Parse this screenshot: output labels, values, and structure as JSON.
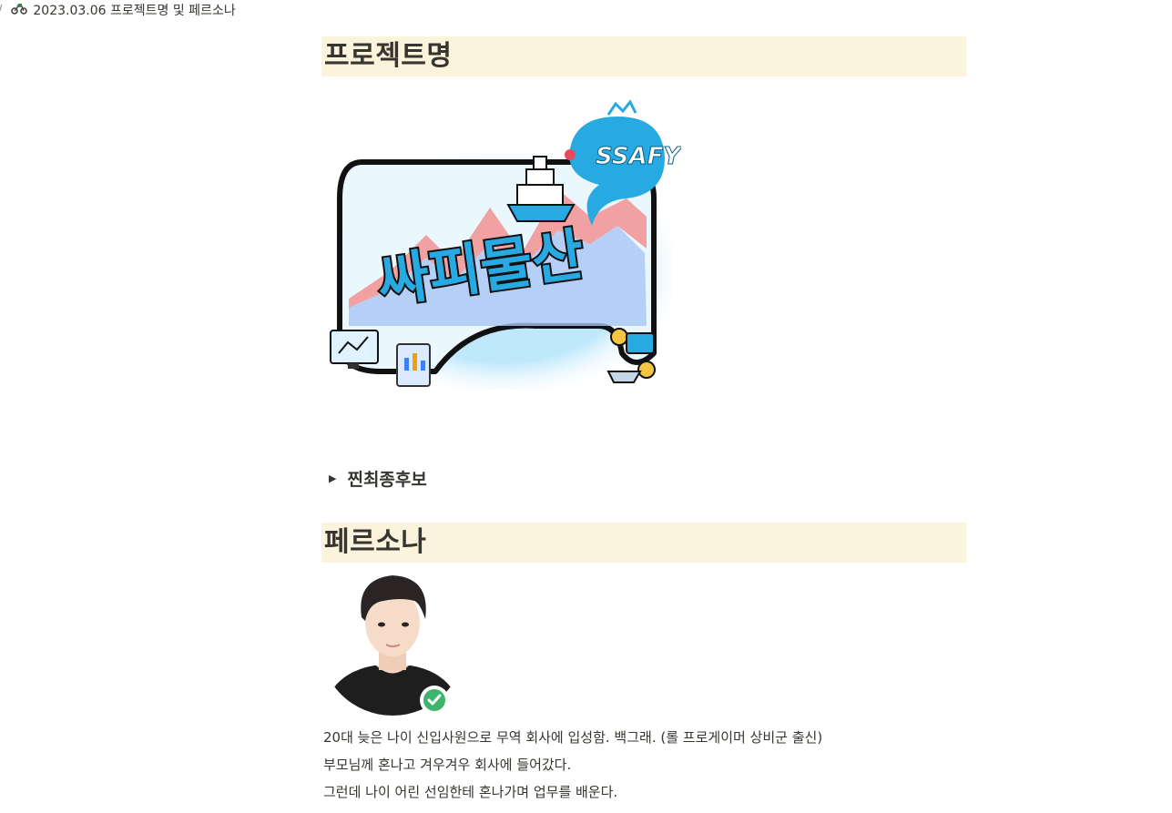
{
  "breadcrumb": {
    "separator": "/",
    "page_icon": "motorcycle-icon",
    "title": "2023.03.06 프로젝트명 및 페르소나"
  },
  "sections": {
    "project": {
      "heading": "프로젝트명",
      "logo": {
        "title_text": "싸피물산",
        "badge_text": "SSAFY"
      },
      "toggle": {
        "label": "찐최종후보",
        "expanded": false
      }
    },
    "persona": {
      "heading": "페르소나",
      "avatar_badge": "check-icon",
      "paragraphs": [
        "20대 늦은 나이 신입사원으로 무역 회사에 입성함. 백그래. (롤 프로게이머 상비군 출신)",
        "부모님께 혼나고 겨우겨우 회사에 들어갔다.",
        "그런데 나이 어린 선임한테 혼나가며 업무를 배운다."
      ]
    }
  },
  "colors": {
    "heading_bg": "#fbf3db",
    "text": "#37352f",
    "logo_blue": "#27aae1",
    "chart_red": "#f28b8b",
    "chart_blue": "#a9c4f5",
    "badge_green": "#3eb46d"
  }
}
